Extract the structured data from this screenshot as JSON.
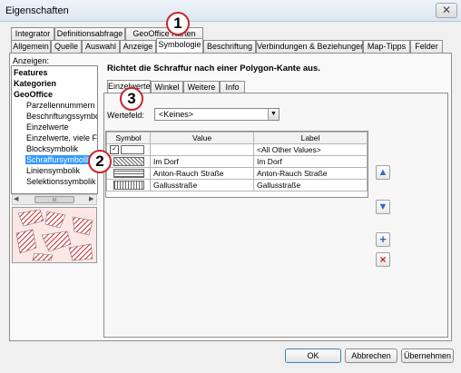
{
  "window": {
    "title": "Eigenschaften",
    "close": "✕"
  },
  "tabs_row1": [
    "Integrator",
    "Definitionsabfrage",
    "GeoOffice Karten"
  ],
  "tabs_row2": [
    "Allgemein",
    "Quelle",
    "Auswahl",
    "Anzeige",
    "Symbologie",
    "Beschriftung",
    "Verbindungen & Beziehungen",
    "Map-Tipps",
    "Felder"
  ],
  "left": {
    "label": "Anzeigen:",
    "items": [
      "Features",
      "Kategorien",
      "GeoOffice",
      "Parzellennummern",
      "Beschriftungssymbol",
      "Einzelwerte",
      "Einzelwerte, viele Fe",
      "Blocksymbolik",
      "Schraffursymbolik",
      "Liniensymbolik",
      "Selektionssymbolik"
    ],
    "scroll_left": "◀",
    "scroll_right": "▶",
    "scroll_grip": "III"
  },
  "right": {
    "heading": "Richtet die Schraffur nach einer Polygon-Kante aus.",
    "subtabs": [
      "Einzelwerte",
      "Winkel",
      "Weitere",
      "Info"
    ],
    "field_label": "Wertefeld:",
    "field_value": "<Keines>",
    "table_headers": [
      "Symbol",
      "Value",
      "Label"
    ],
    "rows": [
      {
        "value": "",
        "label": "<All Other Values>"
      },
      {
        "value": "Im Dorf",
        "label": "Im Dorf"
      },
      {
        "value": "Anton-Rauch Straße",
        "label": "Anton-Rauch Straße"
      },
      {
        "value": "Gallusstraße",
        "label": "Gallusstraße"
      }
    ]
  },
  "side_buttons": {
    "up": "▲",
    "down": "▼",
    "add": "+",
    "remove": "×"
  },
  "badges": [
    "1",
    "2",
    "3"
  ],
  "buttons": {
    "ok": "OK",
    "cancel": "Abbrechen",
    "apply": "Übernehmen"
  },
  "colors": {
    "badge": "#c8262a",
    "selection": "#3399ff",
    "icon_blue": "#2b6cc4",
    "icon_red": "#d02020"
  }
}
